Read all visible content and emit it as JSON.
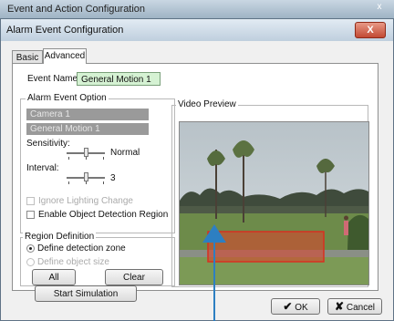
{
  "outer_window": {
    "title": "Event and Action Configuration",
    "close_glyph": "x"
  },
  "dialog": {
    "title": "Alarm Event Configuration",
    "close_glyph": "X"
  },
  "tabs": [
    {
      "label": "Basic"
    },
    {
      "label": "Advanced"
    }
  ],
  "event_name": {
    "label": "Event Name:",
    "value": "General Motion 1"
  },
  "alarm_event_option": {
    "title": "Alarm Event Option",
    "items": [
      "Camera 1",
      "General Motion 1"
    ],
    "sensitivity": {
      "label": "Sensitivity:",
      "value_text": "Normal",
      "level": 0.5
    },
    "interval": {
      "label": "Interval:",
      "value_text": "3",
      "level": 0.5
    },
    "ignore_lighting": {
      "label": "Ignore Lighting Change",
      "checked": false,
      "enabled": false
    },
    "object_detection": {
      "label": "Enable Object Detection Region",
      "checked": false,
      "enabled": true
    }
  },
  "region_definition": {
    "title": "Region Definition",
    "define_detection": {
      "label": "Define detection zone",
      "selected": true
    },
    "define_object": {
      "label": "Define object size",
      "selected": false,
      "enabled": false
    },
    "all_label": "All",
    "clear_label": "Clear"
  },
  "video_preview": {
    "title": "Video Preview",
    "zone_color": "#e0402a"
  },
  "start_simulation_label": "Start Simulation",
  "ok_label": "OK",
  "cancel_label": "Cancel",
  "colors": {
    "accent_arrow": "#2d7fc2",
    "event_name_bg": "#d5f2d3"
  }
}
